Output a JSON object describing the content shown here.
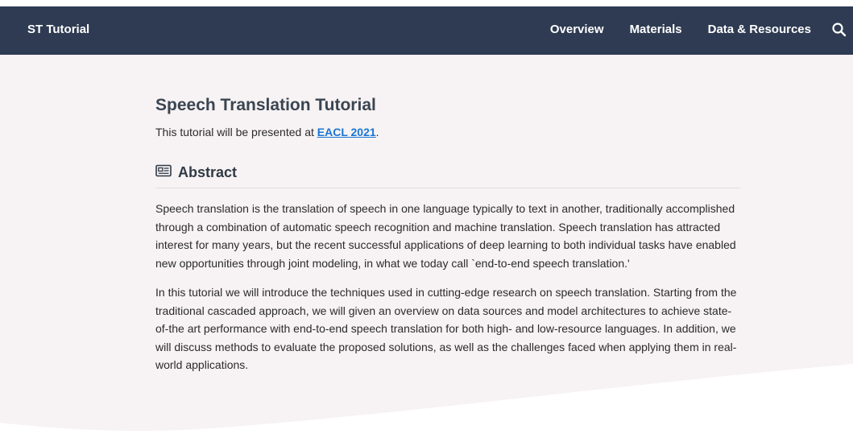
{
  "nav": {
    "brand": "ST Tutorial",
    "links": [
      "Overview",
      "Materials",
      "Data & Resources"
    ],
    "search_icon": "search-icon"
  },
  "main": {
    "title": "Speech Translation Tutorial",
    "intro_prefix": "This tutorial will be presented at ",
    "intro_link": "EACL 2021",
    "intro_suffix": ".",
    "abstract": {
      "icon": "newspaper-icon",
      "heading": "Abstract",
      "paragraphs": [
        "Speech translation is the translation of speech in one language typically to text in another, traditionally accomplished through a combination of automatic speech recognition and machine translation. Speech translation has attracted interest for many years, but the recent successful applications of deep learning to both individual tasks have enabled new opportunities through joint modeling, in what we today call `end-to-end speech translation.'",
        "In this tutorial we will introduce the techniques used in cutting-edge research on speech translation. Starting from the traditional cascaded approach, we will given an overview on data sources and model architectures to achieve state-of-the art performance with end-to-end speech translation for both high- and low-resource languages. In addition, we will discuss methods to evaluate the proposed solutions, as well as the challenges faced when applying them in real-world applications."
      ]
    }
  },
  "colors": {
    "navbar": "#2e3b52",
    "content_bg": "#f7f2f3",
    "link": "#1976d2"
  }
}
